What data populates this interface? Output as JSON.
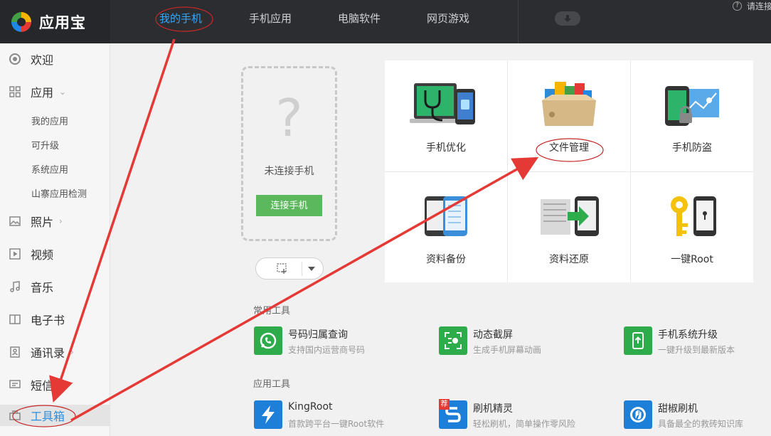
{
  "app": {
    "name": "应用宝"
  },
  "nav": {
    "tabs": [
      {
        "label": "我的手机",
        "active": true
      },
      {
        "label": "手机应用",
        "active": false
      },
      {
        "label": "电脑软件",
        "active": false
      },
      {
        "label": "网页游戏",
        "active": false
      }
    ],
    "help_label": "请连接"
  },
  "sidebar": {
    "items": [
      {
        "label": "欢迎",
        "icon": "welcome-icon"
      },
      {
        "label": "应用",
        "icon": "apps-grid-icon",
        "arrow": "⌄"
      },
      {
        "label": "照片",
        "icon": "photo-icon",
        "arrow": "›"
      },
      {
        "label": "视频",
        "icon": "video-icon"
      },
      {
        "label": "音乐",
        "icon": "music-icon"
      },
      {
        "label": "电子书",
        "icon": "ebook-icon"
      },
      {
        "label": "通讯录",
        "icon": "contacts-icon",
        "arrow": "›"
      },
      {
        "label": "短信",
        "icon": "sms-icon"
      },
      {
        "label": "工具箱",
        "icon": "toolbox-icon",
        "active": true
      }
    ],
    "app_subitems": [
      "我的应用",
      "可升级",
      "系统应用",
      "山寨应用检测"
    ]
  },
  "connect": {
    "question_mark": "?",
    "status": "未连接手机",
    "button_label": "连接手机"
  },
  "features": [
    {
      "label": "手机优化",
      "icon": "phone-optimize-icon"
    },
    {
      "label": "文件管理",
      "icon": "file-manager-icon"
    },
    {
      "label": "手机防盗",
      "icon": "anti-theft-icon"
    },
    {
      "label": "资料备份",
      "icon": "data-backup-icon"
    },
    {
      "label": "资料还原",
      "icon": "data-restore-icon"
    },
    {
      "label": "一键Root",
      "icon": "one-key-root-icon"
    }
  ],
  "common_tools": {
    "title": "常用工具",
    "items": [
      {
        "name": "号码归属查询",
        "desc": "支持国内运营商号码",
        "icon": "phone-lookup-icon",
        "color": "#2eab4b"
      },
      {
        "name": "动态截屏",
        "desc": "生成手机屏幕动画",
        "icon": "dynamic-screenshot-icon",
        "color": "#2eab4b"
      },
      {
        "name": "手机系统升级",
        "desc": "一键升级到最新版本",
        "icon": "system-upgrade-icon",
        "color": "#2eab4b"
      }
    ]
  },
  "app_tools": {
    "title": "应用工具",
    "items": [
      {
        "name": "KingRoot",
        "desc": "首款跨平台一键Root软件",
        "icon": "kingroot-icon",
        "color": "#1d7fd8"
      },
      {
        "name": "刷机精灵",
        "desc": "轻松刷机，简单操作零风险",
        "icon": "flash-wizard-icon",
        "color": "#1d7fd8",
        "badge": "荐"
      },
      {
        "name": "甜椒刷机",
        "desc": "具备最全的救砖知识库",
        "icon": "tianjiao-flash-icon",
        "color": "#1d7fd8"
      }
    ]
  },
  "colors": {
    "topbar": "#2b2d30",
    "accent_blue": "#33a8ff",
    "connect_green": "#5cb85c",
    "annotation_red": "#e53935"
  }
}
